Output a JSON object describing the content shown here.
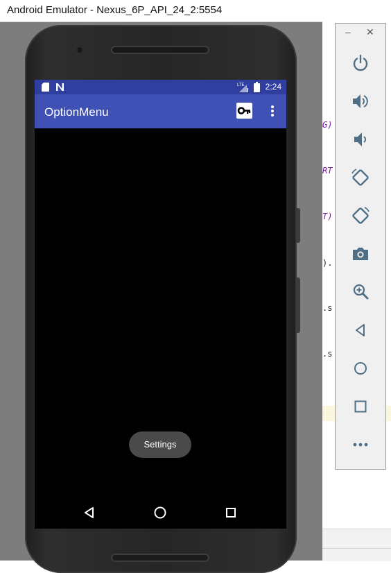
{
  "window": {
    "title": "Android Emulator - Nexus_6P_API_24_2:5554"
  },
  "status_bar": {
    "time": "2:24",
    "color": "#303f9f"
  },
  "app_bar": {
    "title": "OptionMenu",
    "color": "#3f51b5",
    "actions": [
      {
        "name": "key-icon"
      },
      {
        "name": "more-vert-icon"
      }
    ]
  },
  "toast": {
    "text": "Settings"
  },
  "navigation_bar": {
    "buttons": [
      "back-icon",
      "home-icon",
      "recents-icon"
    ]
  },
  "extended_controls": {
    "minimize_label": "–",
    "close_label": "✕",
    "buttons": [
      "power-icon",
      "volume-up-icon",
      "volume-down-icon",
      "rotate-left-icon",
      "rotate-right-icon",
      "camera-icon",
      "zoom-icon",
      "back-icon",
      "home-icon",
      "overview-icon",
      "more-icon"
    ]
  },
  "ide_background": {
    "fragments": [
      "G)",
      "RT",
      "T)",
      ").",
      ".s",
      ".s"
    ]
  }
}
